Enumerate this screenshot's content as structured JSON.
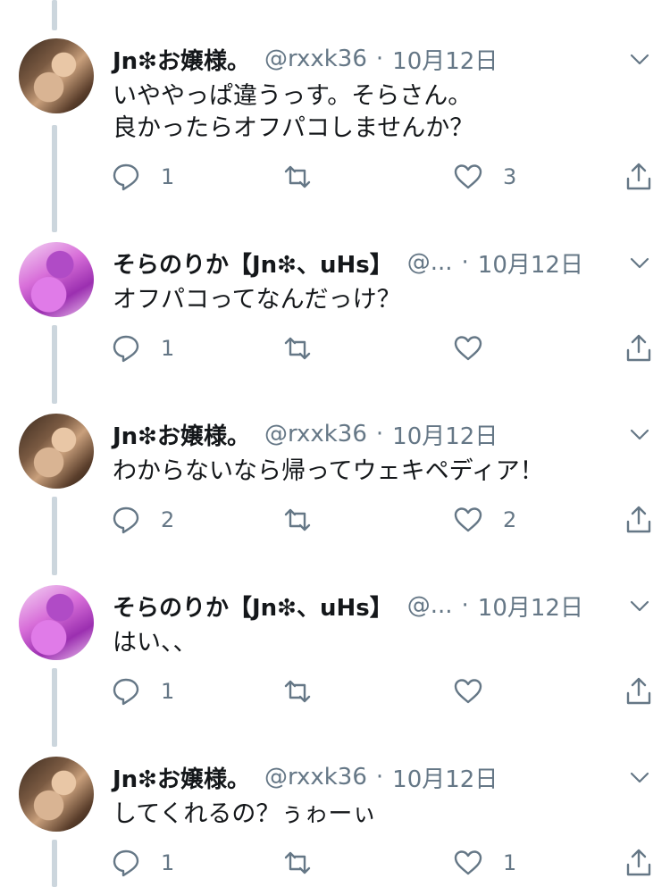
{
  "tweets": [
    {
      "name": "Jn❇お嬢様。",
      "handle": "@rxxk36",
      "dot": "·",
      "date": "10月12日",
      "text": "いややっぱ違うっす。そらさん。\n良かったらオフパコしませんか？",
      "replies": "1",
      "retweets": "",
      "likes": "3"
    },
    {
      "name": "そらのりか【Jn❇、uHs】",
      "handle": "@...",
      "dot": "·",
      "date": "10月12日",
      "text": "オフパコってなんだっけ？",
      "replies": "1",
      "retweets": "",
      "likes": ""
    },
    {
      "name": "Jn❇お嬢様。",
      "handle": "@rxxk36",
      "dot": "·",
      "date": "10月12日",
      "text": "わからないなら帰ってウェキペディア！",
      "replies": "2",
      "retweets": "",
      "likes": "2"
    },
    {
      "name": "そらのりか【Jn❇、uHs】",
      "handle": "@...",
      "dot": "·",
      "date": "10月12日",
      "text": "はい、、",
      "replies": "1",
      "retweets": "",
      "likes": ""
    },
    {
      "name": "Jn❇お嬢様。",
      "handle": "@rxxk36",
      "dot": "·",
      "date": "10月12日",
      "text": "してくれるの？ぅゎーぃ",
      "replies": "1",
      "retweets": "",
      "likes": "1"
    }
  ],
  "colors": {
    "thread_line": "#ccd6dd",
    "text": "#14171a",
    "muted": "#657786",
    "icon": "#657786"
  }
}
